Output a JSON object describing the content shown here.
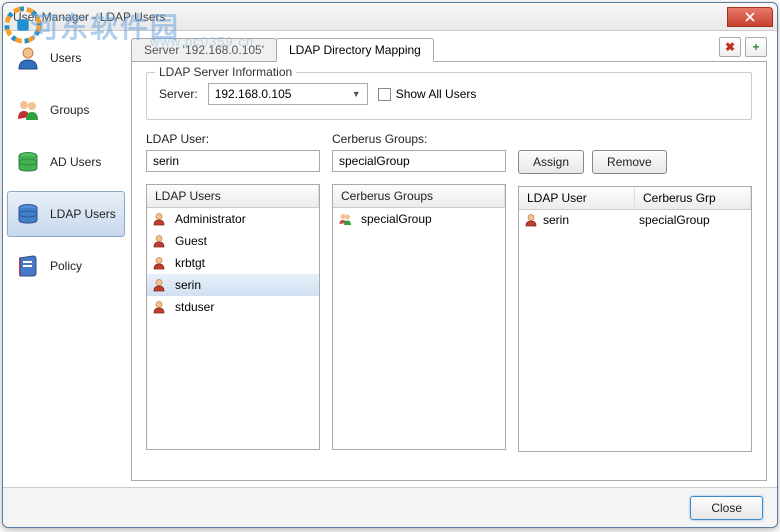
{
  "watermark": {
    "text": "河东软件园",
    "url": "www.pc0359.cn"
  },
  "window": {
    "title": "User Manager - LDAP Users"
  },
  "sidebar": {
    "items": [
      {
        "label": "Users"
      },
      {
        "label": "Groups"
      },
      {
        "label": "AD Users"
      },
      {
        "label": "LDAP Users"
      },
      {
        "label": "Policy"
      }
    ]
  },
  "tabs": {
    "items": [
      {
        "label": "Server '192.168.0.105'"
      },
      {
        "label": "LDAP Directory Mapping"
      }
    ]
  },
  "server_info": {
    "legend": "LDAP Server Information",
    "server_label": "Server:",
    "server_value": "192.168.0.105",
    "show_all_label": "Show All Users"
  },
  "ldap_user": {
    "label": "LDAP User:",
    "value": "serin",
    "list_header": "LDAP Users",
    "users": [
      "Administrator",
      "Guest",
      "krbtgt",
      "serin",
      "stduser"
    ],
    "selected_index": 3
  },
  "cerberus": {
    "label": "Cerberus Groups:",
    "value": "specialGroup",
    "list_header": "Cerberus Groups",
    "groups": [
      "specialGroup"
    ]
  },
  "buttons": {
    "assign": "Assign",
    "remove": "Remove",
    "close": "Close"
  },
  "mapping": {
    "col1": "LDAP User",
    "col2": "Cerberus Grp",
    "rows": [
      {
        "user": "serin",
        "group": "specialGroup"
      }
    ]
  }
}
